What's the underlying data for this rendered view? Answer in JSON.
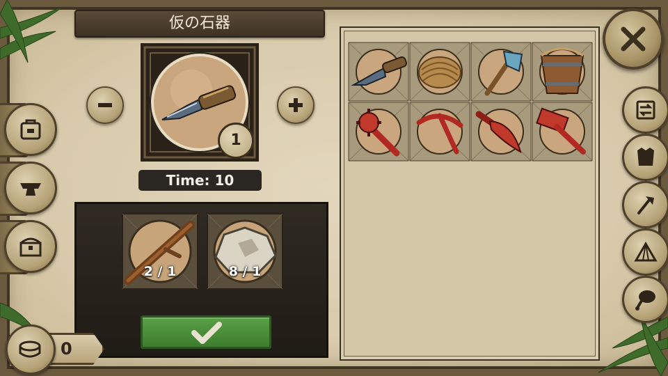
{
  "title": "仮の石器",
  "product": {
    "name": "stone knife",
    "quantity": "1",
    "time_text": "Time: 10"
  },
  "ingredients": [
    {
      "icon": "stick-icon",
      "text": "2 / 1"
    },
    {
      "icon": "stone-icon",
      "text": "8 / 1"
    }
  ],
  "recipes": [
    {
      "icon": "stone-knife-icon"
    },
    {
      "icon": "rope-icon"
    },
    {
      "icon": "stone-axe-icon"
    },
    {
      "icon": "wooden-bucket-icon"
    },
    {
      "icon": "spiked-club-icon"
    },
    {
      "icon": "pickaxe-icon"
    },
    {
      "icon": "machete-icon"
    },
    {
      "icon": "hammer-icon"
    }
  ],
  "currency": {
    "amount": "0"
  },
  "left_menu": [
    "backpack-icon",
    "anvil-icon",
    "chest-icon"
  ],
  "right_menu": [
    "swap-icon",
    "armor-icon",
    "axe-icon",
    "tent-icon",
    "meat-icon"
  ],
  "colors": {
    "parchment": "#d8caab",
    "dark_panel": "#2a2622",
    "confirm_green": "#4a8f3a",
    "title_text": "#f1e8d4"
  }
}
